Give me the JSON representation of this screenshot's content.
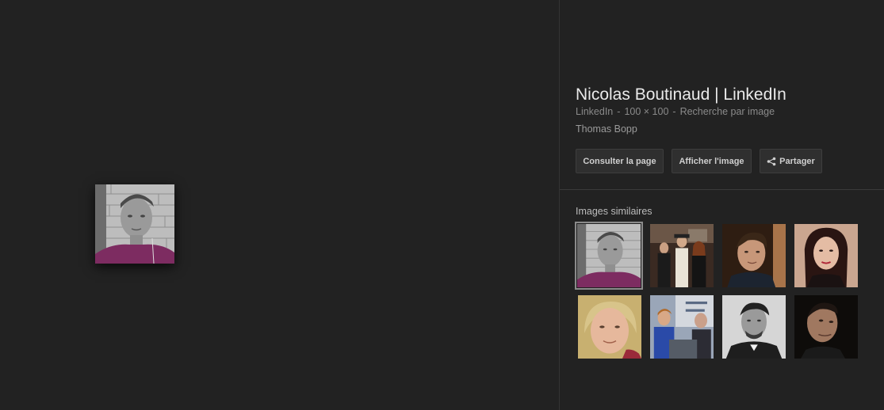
{
  "panel": {
    "title": "Nicolas Boutinaud | LinkedIn",
    "meta_source": "LinkedIn",
    "meta_size": "100 × 100",
    "meta_search": "Recherche par image",
    "meta_sep": "-",
    "owner": "Thomas Bopp"
  },
  "buttons": {
    "visit": "Consulter la page",
    "view": "Afficher l'image",
    "share": "Partager"
  },
  "similar": {
    "label": "Images similaires"
  },
  "icons": {
    "share": "share-icon"
  }
}
